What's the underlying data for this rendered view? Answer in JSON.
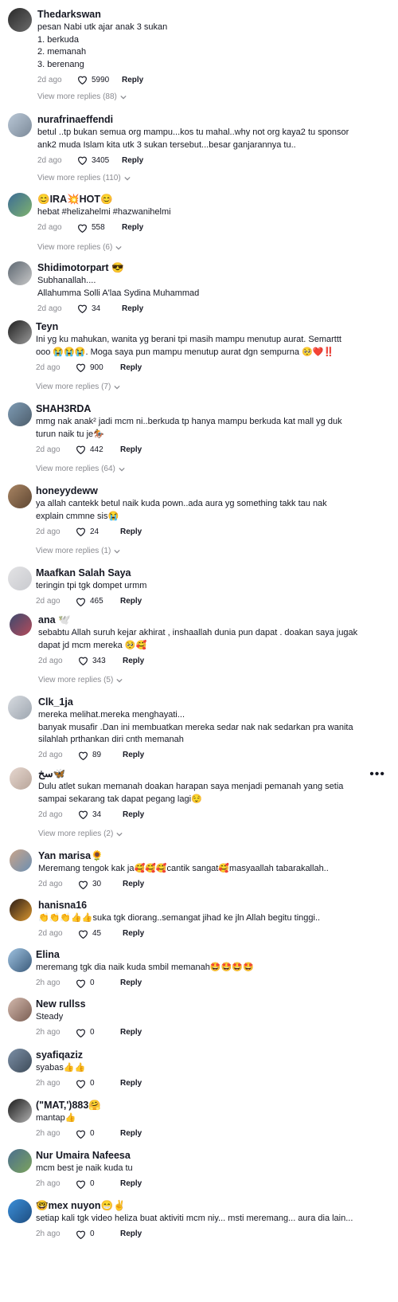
{
  "reply_label": "Reply",
  "comments": [
    {
      "user": "Thedarkswan",
      "lines": [
        "pesan Nabi utk ajar anak 3 sukan",
        "1. berkuda",
        "2. memanah",
        "3. berenang"
      ],
      "time": "2d ago",
      "likes": "5990",
      "more": "View more replies (88)",
      "avatar_colors": [
        "#2a2a2a",
        "#6b6b6b"
      ]
    },
    {
      "user": "nurafrinaeffendi",
      "lines": [
        "betul ..tp bukan semua org mampu...kos tu mahal..why not org kaya2 tu sponsor",
        "ank2 muda Islam kita utk 3 sukan tersebut...besar ganjarannya tu.."
      ],
      "time": "2d ago",
      "likes": "3405",
      "more": "View more replies (110)",
      "avatar_colors": [
        "#b9c7d6",
        "#7c8a99"
      ]
    },
    {
      "user": "😊IRA💥HOT😊",
      "lines": [
        "hebat #helizahelmi #hazwanihelmi"
      ],
      "time": "2d ago",
      "likes": "558",
      "more": "View more replies (6)",
      "avatar_colors": [
        "#3b6b96",
        "#7fb36e"
      ]
    },
    {
      "user": "Shidimotorpart 😎",
      "lines": [
        "Subhanallah....",
        "Allahumma Solli A'laa Sydina Muhammad"
      ],
      "time": "2d ago",
      "likes": "34",
      "more": "",
      "avatar_colors": [
        "#5c6670",
        "#c8c8c8"
      ]
    },
    {
      "user": "Teyn",
      "lines": [
        "Ini yg ku mahukan, wanita yg berani tpi masih mampu menutup aurat. Semarttt",
        "ooo 😭😭😭. Moga saya pun mampu menutup aurat dgn sempurna 🥺❤️‼️"
      ],
      "time": "2d ago",
      "likes": "900",
      "more": "View more replies (7)",
      "avatar_colors": [
        "#1e1e1e",
        "#9a9a9a"
      ]
    },
    {
      "user": "SHAH3RDA",
      "lines": [
        "mmg nak anak² jadi mcm ni..berkuda tp hanya mampu berkuda kat mall yg duk",
        "turun naik tu je🏇"
      ],
      "time": "2d ago",
      "likes": "442",
      "more": "View more replies (64)",
      "avatar_colors": [
        "#7e9cb5",
        "#4d5d6b"
      ]
    },
    {
      "user": "honeyydeww",
      "lines": [
        "ya allah cantekk betul naik kuda pown..ada aura yg something takk tau nak",
        "explain cmmne sis😭"
      ],
      "time": "2d ago",
      "likes": "24",
      "more": "View more replies (1)",
      "avatar_colors": [
        "#a98563",
        "#5e4632"
      ]
    },
    {
      "user": "Maafkan Salah Saya",
      "lines": [
        "teringin tpi tgk dompet urmm"
      ],
      "time": "2d ago",
      "likes": "465",
      "more": "",
      "avatar_colors": [
        "#e3e3e5",
        "#c9cacf"
      ]
    },
    {
      "user": "ana 🕊️",
      "lines": [
        "sebabtu Allah suruh kejar akhirat , inshaallah dunia pun dapat . doakan saya jugak",
        "dapat jd mcm mereka 🥺🥰"
      ],
      "time": "2d ago",
      "likes": "343",
      "more": "View more replies (5)",
      "avatar_colors": [
        "#3c4a6e",
        "#b54b5b"
      ]
    },
    {
      "user": "Clk_1ja",
      "lines": [
        "mereka melihat.mereka menghayati...",
        "banyak musafir .Dan ini membuatkan mereka sedar nak nak sedarkan pra wanita",
        "silahlah prthankan diri cnth memanah"
      ],
      "time": "2d ago",
      "likes": "89",
      "more": "",
      "avatar_colors": [
        "#d7dbe0",
        "#9ea6b0"
      ]
    },
    {
      "user": "سخ🦋",
      "lines": [
        "Dulu atlet sukan memanah doakan harapan saya menjadi pemanah yang setia",
        "sampai sekarang tak dapat pegang lagi😌"
      ],
      "time": "2d ago",
      "likes": "34",
      "more": "View more replies (2)",
      "avatar_colors": [
        "#e6d7cf",
        "#b8a59a"
      ],
      "menu": "•••"
    },
    {
      "user": "Yan marisa🌻",
      "lines": [
        "Meremang tengok kak ja🥰🥰🥰cantik sangat🥰masyaallah tabarakallah.."
      ],
      "time": "2d ago",
      "likes": "30",
      "more": "",
      "avatar_colors": [
        "#c9a48a",
        "#6b8fb2"
      ]
    },
    {
      "user": "hanisna16",
      "lines": [
        "👏👏👏👍👍suka tgk diorang..semangat jihad ke jln Allah begitu tinggi.."
      ],
      "time": "2d ago",
      "likes": "45",
      "more": "",
      "avatar_colors": [
        "#2b1d18",
        "#d9962e"
      ]
    },
    {
      "user": "Elina",
      "lines": [
        "meremang tgk dia naik kuda smbil memanah🤩🤩🤩🤩"
      ],
      "time": "2h ago",
      "likes": "0",
      "more": "",
      "avatar_colors": [
        "#9fc2e0",
        "#3a5a7a"
      ]
    },
    {
      "user": "New rullss",
      "lines": [
        "Steady"
      ],
      "time": "2h ago",
      "likes": "0",
      "more": "",
      "avatar_colors": [
        "#d3b9ad",
        "#7a5d52"
      ]
    },
    {
      "user": "syafiqaziz",
      "lines": [
        "syabas👍👍"
      ],
      "time": "2h ago",
      "likes": "0",
      "more": "",
      "avatar_colors": [
        "#7b8fa6",
        "#3e4b59"
      ]
    },
    {
      "user": "(\"MAT,')883🤗",
      "lines": [
        "mantap👍"
      ],
      "time": "2h ago",
      "likes": "0",
      "more": "",
      "avatar_colors": [
        "#1a1a1a",
        "#b0b0b0"
      ]
    },
    {
      "user": "Nur Umaira Nafeesa",
      "lines": [
        "mcm best je naik kuda tu"
      ],
      "time": "2h ago",
      "likes": "0",
      "more": "",
      "avatar_colors": [
        "#4a6e8f",
        "#7ca35c"
      ]
    },
    {
      "user": "🤓mex nuyon😁✌️",
      "lines": [
        "setiap kali tgk video heliza buat aktiviti mcm niy... msti meremang... aura dia lain..."
      ],
      "time": "2h ago",
      "likes": "0",
      "more": "",
      "avatar_colors": [
        "#3b8fd9",
        "#1e4d80"
      ]
    }
  ]
}
